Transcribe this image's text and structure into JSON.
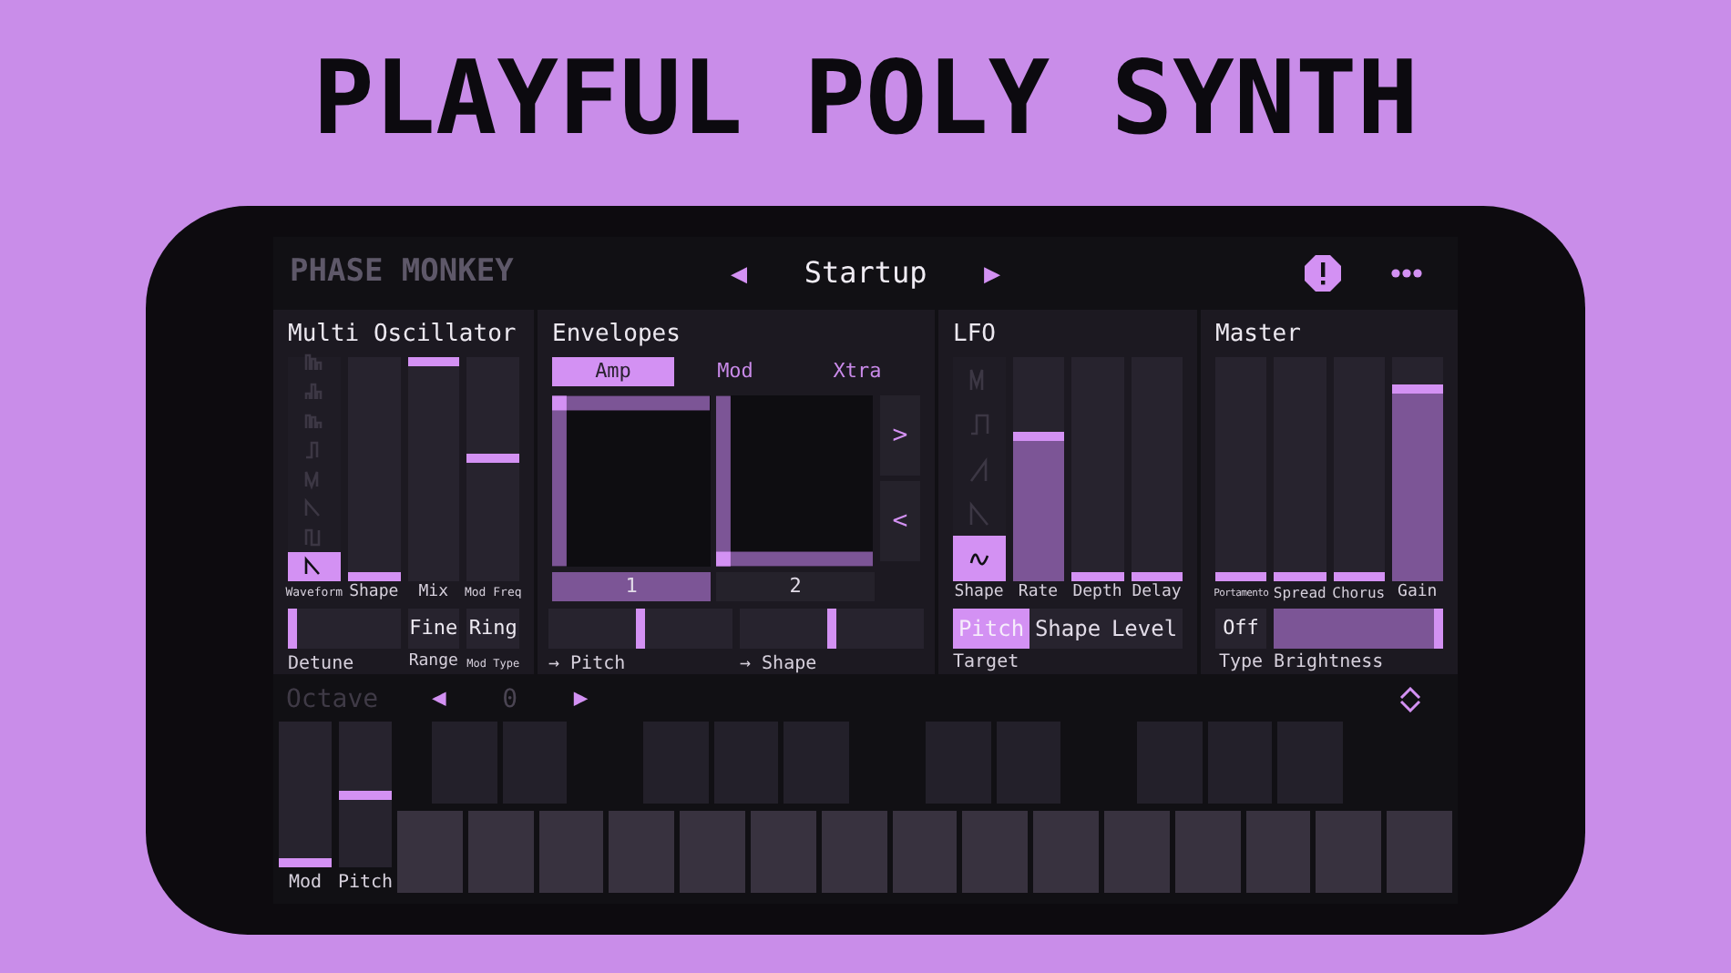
{
  "headline": "PLAYFUL POLY SYNTH",
  "header": {
    "brand": "PHASE MONKEY",
    "preset": "Startup",
    "prev": "◀",
    "next": "▶"
  },
  "oscillator": {
    "title": "Multi Oscillator",
    "waveforms": [
      {
        "selected": false
      },
      {
        "selected": false
      },
      {
        "selected": false
      },
      {
        "selected": false
      },
      {
        "selected": false
      },
      {
        "selected": false
      },
      {
        "selected": false
      },
      {
        "selected": true
      }
    ],
    "waveform_label": "Waveform",
    "faders": [
      {
        "label": "Shape",
        "level": 0
      },
      {
        "label": "Mix",
        "level": 1
      },
      {
        "label": "Mod Freq",
        "level": 0.55
      }
    ],
    "detune": {
      "label": "Detune",
      "level": 0
    },
    "range": {
      "value": "Fine",
      "label": "Range"
    },
    "mod_type": {
      "value": "Ring",
      "label": "Mod Type"
    }
  },
  "envelopes": {
    "title": "Envelopes",
    "tabs": [
      {
        "label": "Amp",
        "selected": true
      },
      {
        "label": "Mod",
        "selected": false
      },
      {
        "label": "Xtra",
        "selected": false
      }
    ],
    "next": ">",
    "prev": "<",
    "pages": [
      {
        "label": "1",
        "selected": true
      },
      {
        "label": "2",
        "selected": false
      }
    ],
    "sliders": [
      {
        "label": "→ Pitch",
        "level": 0.5
      },
      {
        "label": "→ Shape",
        "level": 0.5
      }
    ]
  },
  "lfo": {
    "title": "LFO",
    "shapes": [
      {
        "selected": false
      },
      {
        "selected": false
      },
      {
        "selected": false
      },
      {
        "selected": false
      },
      {
        "selected": true
      }
    ],
    "shape_label": "Shape",
    "faders": [
      {
        "label": "Rate",
        "level": 0.65
      },
      {
        "label": "Depth",
        "level": 0
      },
      {
        "label": "Delay",
        "level": 0
      }
    ],
    "targets": [
      {
        "label": "Pitch",
        "selected": true
      },
      {
        "label": "Shape",
        "selected": false
      },
      {
        "label": "Level",
        "selected": false
      }
    ],
    "target_label": "Target"
  },
  "master": {
    "title": "Master",
    "faders": [
      {
        "label": "Portamento",
        "level": 0
      },
      {
        "label": "Spread",
        "level": 0
      },
      {
        "label": "Chorus",
        "level": 0
      },
      {
        "label": "Gain",
        "level": 0.87
      }
    ],
    "type": {
      "value": "Off",
      "label": "Type"
    },
    "brightness": {
      "label": "Brightness",
      "level": 1
    }
  },
  "keyboard": {
    "octave_label": "Octave",
    "prev": "◀",
    "octave": "0",
    "next": "▶",
    "wheels": [
      {
        "label": "Mod",
        "level": 0
      },
      {
        "label": "Pitch",
        "level": 0.5
      }
    ]
  }
}
